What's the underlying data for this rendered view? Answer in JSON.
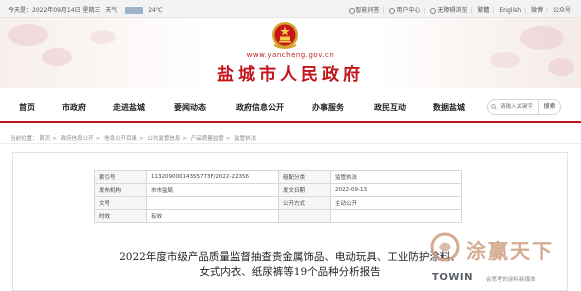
{
  "topbar": {
    "date": "今天是：2022年09月14日 星期三",
    "weather_label": "天气",
    "temperature": "24℃",
    "links": [
      "智能问答",
      "用户中心",
      "无障碍浏览",
      "繁體",
      "English",
      "微博",
      "公众号"
    ]
  },
  "header": {
    "domain": "www.yancheng.gov.cn",
    "site_name": "盐城市人民政府"
  },
  "nav": {
    "items": [
      "首页",
      "市政府",
      "走进盐城",
      "要闻动态",
      "政府信息公开",
      "办事服务",
      "政民互动",
      "数据盐城"
    ],
    "search_placeholder": "请输入关键字",
    "search_button": "搜索"
  },
  "breadcrumb": {
    "prefix": "当前位置：",
    "items": [
      "首页",
      "政府信息公开",
      "信息公开目录",
      "公共监管信息",
      "产品质量监管",
      "监管执法"
    ]
  },
  "meta": {
    "index_label": "索引号",
    "index_value": "11320900014355773F/2022-22356",
    "category_label": "组配分类",
    "category_value": "监管执法",
    "publisher_label": "发布机构",
    "publisher_value": "市市监局",
    "pubdate_label": "发文日期",
    "pubdate_value": "2022-09-13",
    "docno_label": "文号",
    "docno_value": "",
    "mode_label": "公开方式",
    "mode_value": "主动公开",
    "validity_label": "时效",
    "validity_value": "有效"
  },
  "document": {
    "title_line1": "2022年度市级产品质量监督抽查贵金属饰品、电动玩具、工业防护涂料、",
    "title_line2": "女式内衣、纸尿裤等19个品种分析报告"
  },
  "watermark": {
    "text": "涂赢天下",
    "brand": "TOWIN",
    "slogan": "会思考的涂料新媒体"
  },
  "colors": {
    "brand_red": "#c1141b",
    "watermark_tan": "#ce9e80"
  }
}
